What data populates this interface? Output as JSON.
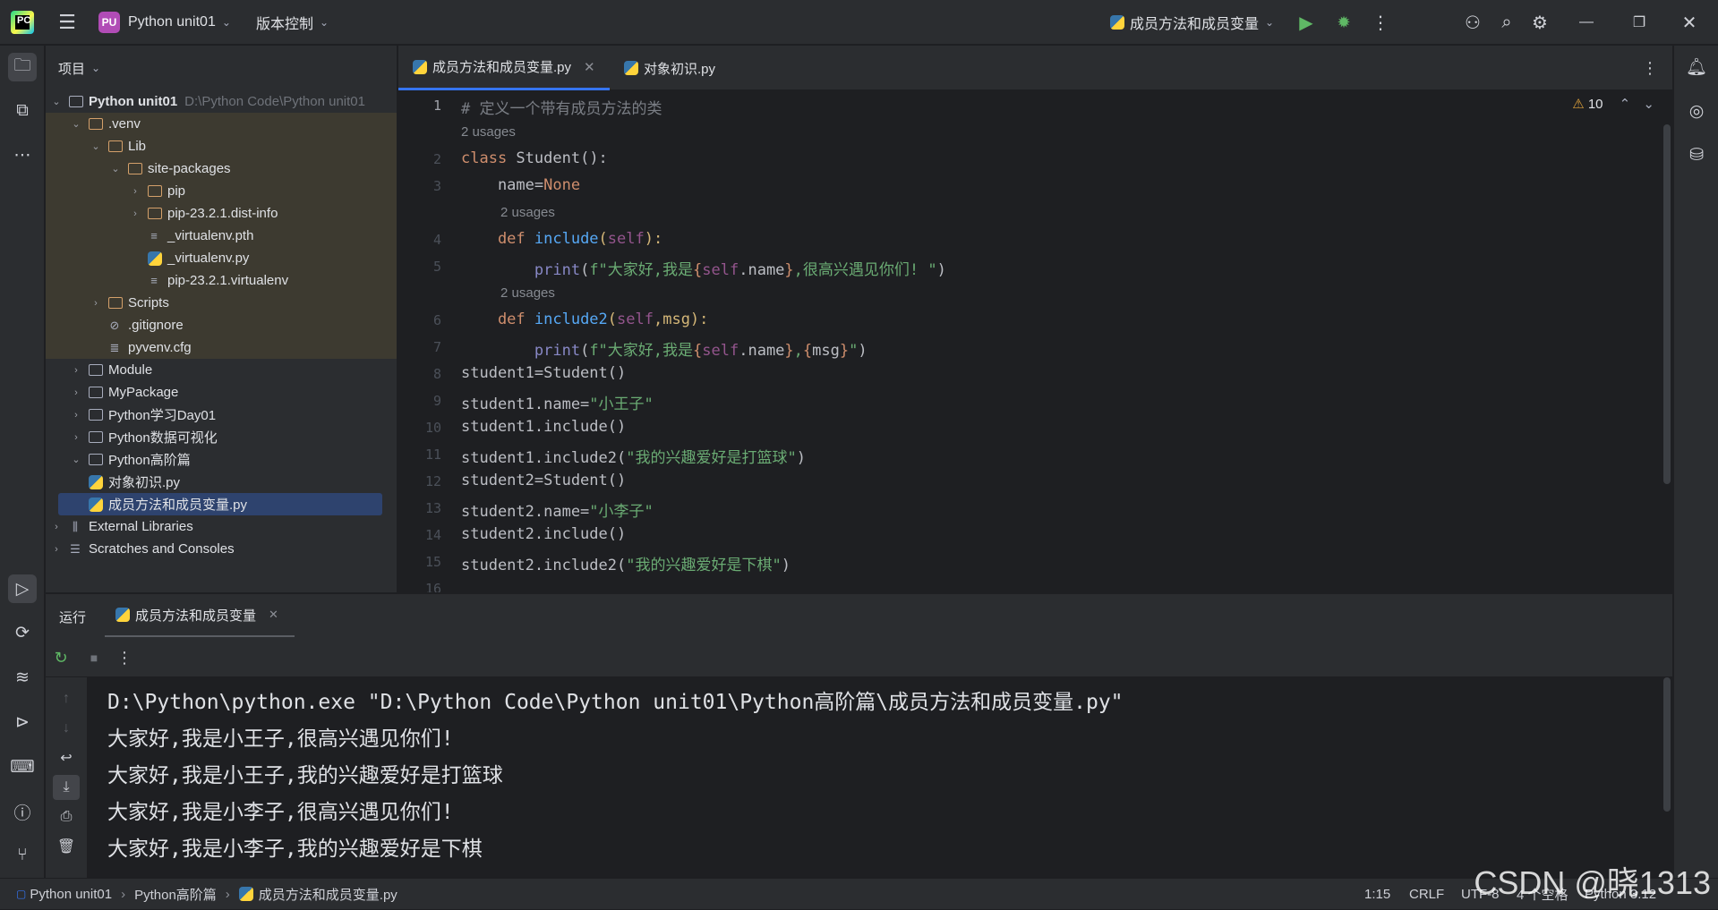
{
  "titlebar": {
    "project_badge": "PU",
    "project_name": "Python unit01",
    "vcs_label": "版本控制",
    "run_config": "成员方法和成员变量"
  },
  "project_panel": {
    "title": "项目",
    "tree": [
      {
        "label": "Python unit01",
        "extra": "D:\\Python Code\\Python unit01"
      },
      {
        "label": ".venv"
      },
      {
        "label": "Lib"
      },
      {
        "label": "site-packages"
      },
      {
        "label": "pip"
      },
      {
        "label": "pip-23.2.1.dist-info"
      },
      {
        "label": "_virtualenv.pth"
      },
      {
        "label": "_virtualenv.py"
      },
      {
        "label": "pip-23.2.1.virtualenv"
      },
      {
        "label": "Scripts"
      },
      {
        "label": ".gitignore"
      },
      {
        "label": "pyvenv.cfg"
      },
      {
        "label": "Module"
      },
      {
        "label": "MyPackage"
      },
      {
        "label": "Python学习Day01"
      },
      {
        "label": "Python数据可视化"
      },
      {
        "label": "Python高阶篇"
      },
      {
        "label": "对象初识.py"
      },
      {
        "label": "成员方法和成员变量.py"
      },
      {
        "label": "External Libraries"
      },
      {
        "label": "Scratches and Consoles"
      }
    ]
  },
  "editor": {
    "tabs": [
      "成员方法和成员变量.py",
      "对象初识.py"
    ],
    "warnings": "10",
    "usage_hint": "2 usages",
    "line_numbers": [
      "1",
      "2",
      "3",
      "4",
      "5",
      "6",
      "7",
      "8",
      "9",
      "10",
      "11",
      "12",
      "13",
      "14",
      "15",
      "16"
    ],
    "lines": {
      "l1": "# 定义一个带有成员方法的类",
      "l2a": "class ",
      "l2b": "Student",
      "l2c": "():",
      "l3a": "    name=",
      "l3b": "None",
      "l4a": "    def ",
      "l4b": "include",
      "l4c": "(",
      "l4d": "self",
      "l4e": "):",
      "l5a": "        print",
      "l5b": "(",
      "l5c": "f\"大家好,我是",
      "l5d": "{",
      "l5e": "self",
      "l5f": ".name",
      "l5g": "}",
      "l5h": ",很高兴遇见你们! \"",
      "l5i": ")",
      "l6a": "    def ",
      "l6b": "include2",
      "l6c": "(",
      "l6d": "self",
      "l6e": ",msg):",
      "l7a": "        print",
      "l7b": "(",
      "l7c": "f\"大家好,我是",
      "l7d": "{",
      "l7e": "self",
      "l7f": ".name",
      "l7g": "}",
      "l7h": ",",
      "l7i": "{",
      "l7j": "msg",
      "l7k": "}",
      "l7l": "\"",
      "l7m": ")",
      "l8": "student1=Student()",
      "l9a": "student1.name=",
      "l9b": "\"小王子\"",
      "l10": "student1.include()",
      "l11a": "student1.include2(",
      "l11b": "\"我的兴趣爱好是打篮球\"",
      "l11c": ")",
      "l12": "student2=Student()",
      "l13a": "student2.name=",
      "l13b": "\"小李子\"",
      "l14": "student2.include()",
      "l15a": "student2.include2(",
      "l15b": "\"我的兴趣爱好是下棋\"",
      "l15c": ")"
    }
  },
  "run_panel": {
    "title": "运行",
    "tab_label": "成员方法和成员变量",
    "output": [
      "D:\\Python\\python.exe \"D:\\Python Code\\Python unit01\\Python高阶篇\\成员方法和成员变量.py\"",
      "大家好,我是小王子,很高兴遇见你们!",
      "大家好,我是小王子,我的兴趣爱好是打篮球",
      "大家好,我是小李子,很高兴遇见你们!",
      "大家好,我是小李子,我的兴趣爱好是下棋"
    ]
  },
  "statusbar": {
    "crumbs": [
      "Python unit01",
      "Python高阶篇",
      "成员方法和成员变量.py"
    ],
    "position": "1:15",
    "line_sep": "CRLF",
    "encoding": "UTF-8",
    "indent": "4 个空格",
    "interpreter": "Python 3.12"
  },
  "watermark": "CSDN @晓1313"
}
